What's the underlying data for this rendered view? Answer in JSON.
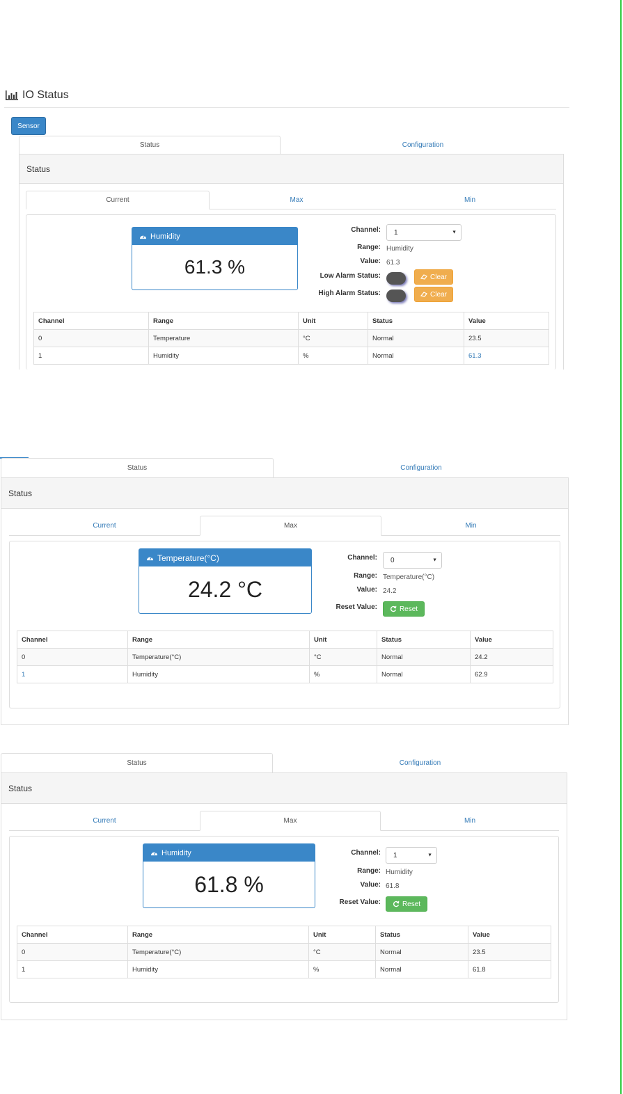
{
  "header": {
    "title": "IO Status",
    "sensor_button": "Sensor"
  },
  "colors": {
    "primary": "#3a87c8",
    "warning": "#f0ad4e",
    "success": "#5cb85c",
    "border_green": "#2ecc40"
  },
  "main_tabs": [
    "Status",
    "Configuration"
  ],
  "sub_tabs": [
    "Current",
    "Max",
    "Min"
  ],
  "panel_title": "Status",
  "labels": {
    "channel": "Channel:",
    "range": "Range:",
    "value": "Value:",
    "low_alarm": "Low Alarm Status:",
    "high_alarm": "High Alarm Status:",
    "reset_value": "Reset Value:",
    "clear": "Clear",
    "reset": "Reset"
  },
  "columns": [
    "Channel",
    "Range",
    "Unit",
    "Status",
    "Value"
  ],
  "sections": [
    {
      "active_sub_tab": "Current",
      "gauge": {
        "title": "Humidity",
        "value": "61.3 %",
        "icon": "dashboard-icon"
      },
      "channel": "1",
      "range": "Humidity",
      "value": "61.3",
      "rows": [
        [
          "0",
          "Temperature",
          "°C",
          "Normal",
          "23.5"
        ],
        [
          "1",
          "Humidity",
          "%",
          "Normal",
          "61.3"
        ]
      ]
    },
    {
      "active_sub_tab": "Max",
      "gauge": {
        "title": "Temperature(°C)",
        "value": "24.2 °C",
        "icon": "dashboard-icon"
      },
      "channel": "0",
      "range": "Temperature(°C)",
      "value": "24.2",
      "rows": [
        [
          "0",
          "Temperature(°C)",
          "°C",
          "Normal",
          "24.2"
        ],
        [
          "1",
          "Humidity",
          "%",
          "Normal",
          "62.9"
        ]
      ]
    },
    {
      "active_sub_tab": "Max",
      "gauge": {
        "title": "Humidity",
        "value": "61.8 %",
        "icon": "dashboard-icon"
      },
      "channel": "1",
      "range": "Humidity",
      "value": "61.8",
      "rows": [
        [
          "0",
          "Temperature(°C)",
          "°C",
          "Normal",
          "23.5"
        ],
        [
          "1",
          "Humidity",
          "%",
          "Normal",
          "61.8"
        ]
      ]
    }
  ]
}
